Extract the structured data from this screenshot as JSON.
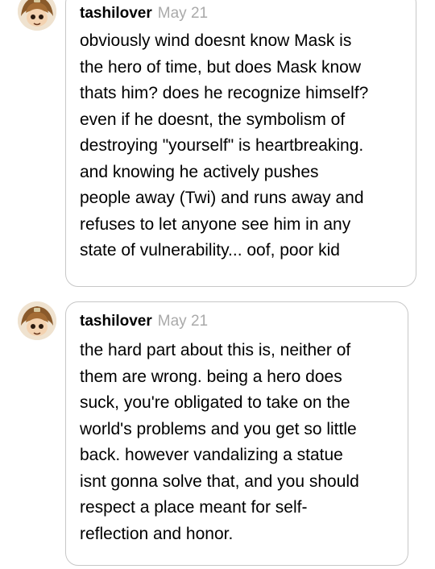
{
  "comments": [
    {
      "username": "tashilover",
      "date": "May 21",
      "avatar_icon": "brown-haired-character-avatar",
      "lines": [
        "obviously wind doesnt know Mask is",
        "the hero of time, but does Mask know",
        "thats him? does he recognize himself?",
        "even if he doesnt, the symbolism of",
        "destroying \"yourself\" is heartbreaking.",
        "and knowing he actively pushes",
        "people away (Twi) and runs away and",
        "refuses to let anyone see him in any",
        "state of vulnerability... oof, poor kid"
      ]
    },
    {
      "username": "tashilover",
      "date": "May 21",
      "avatar_icon": "brown-haired-character-avatar",
      "lines": [
        "the hard part about this is, neither of",
        "them are wrong. being a hero does",
        "suck, you're obligated to take on the",
        "world's problems and you get so little",
        "back. however vandalizing a statue",
        "isnt gonna solve that, and you should",
        "respect a place meant for self-",
        "reflection and honor."
      ]
    }
  ],
  "colors": {
    "bubble_border": "#c7c7c7",
    "date_text": "#aaaaaa",
    "body_text": "#000000"
  }
}
